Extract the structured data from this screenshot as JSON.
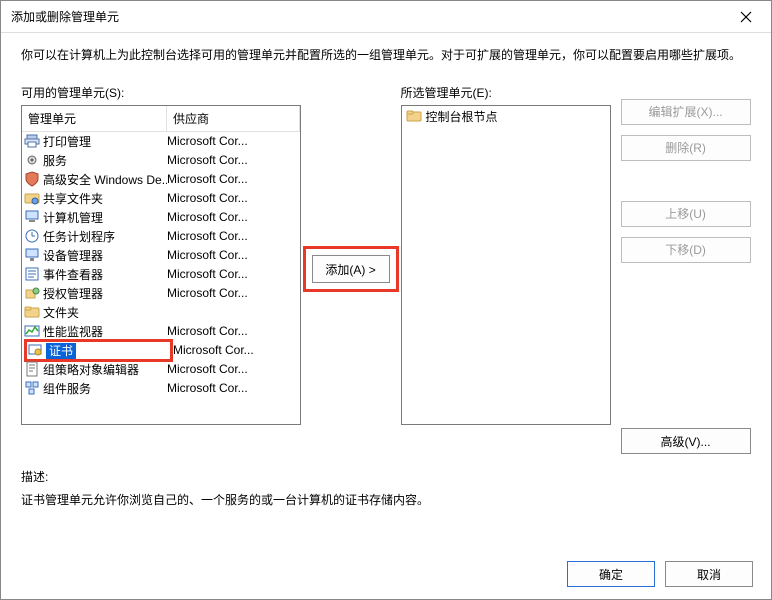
{
  "window": {
    "title": "添加或删除管理单元"
  },
  "intro": "你可以在计算机上为此控制台选择可用的管理单元并配置所选的一组管理单元。对于可扩展的管理单元，你可以配置要启用哪些扩展项。",
  "labels": {
    "available": "可用的管理单元(S):",
    "selected": "所选管理单元(E):",
    "description": "描述:"
  },
  "headers": {
    "name": "管理单元",
    "vendor": "供应商"
  },
  "available_items": [
    {
      "name": "打印管理",
      "vendor": "Microsoft Cor...",
      "icon": "printer"
    },
    {
      "name": "服务",
      "vendor": "Microsoft Cor...",
      "icon": "gear"
    },
    {
      "name": "高级安全 Windows De...",
      "vendor": "Microsoft Cor...",
      "icon": "shield"
    },
    {
      "name": "共享文件夹",
      "vendor": "Microsoft Cor...",
      "icon": "folder-share"
    },
    {
      "name": "计算机管理",
      "vendor": "Microsoft Cor...",
      "icon": "computer"
    },
    {
      "name": "任务计划程序",
      "vendor": "Microsoft Cor...",
      "icon": "clock"
    },
    {
      "name": "设备管理器",
      "vendor": "Microsoft Cor...",
      "icon": "device"
    },
    {
      "name": "事件查看器",
      "vendor": "Microsoft Cor...",
      "icon": "event"
    },
    {
      "name": "授权管理器",
      "vendor": "Microsoft Cor...",
      "icon": "auth"
    },
    {
      "name": "文件夹",
      "vendor": "",
      "icon": "folder"
    },
    {
      "name": "性能监视器",
      "vendor": "Microsoft Cor...",
      "icon": "perf"
    },
    {
      "name": "证书",
      "vendor": "Microsoft Cor...",
      "icon": "cert",
      "selected": true
    },
    {
      "name": "组策略对象编辑器",
      "vendor": "Microsoft Cor...",
      "icon": "policy"
    },
    {
      "name": "组件服务",
      "vendor": "Microsoft Cor...",
      "icon": "component"
    }
  ],
  "selected_root": "控制台根节点",
  "buttons": {
    "add": "添加(A) >",
    "edit_ext": "编辑扩展(X)...",
    "remove": "删除(R)",
    "move_up": "上移(U)",
    "move_down": "下移(D)",
    "advanced": "高级(V)...",
    "ok": "确定",
    "cancel": "取消"
  },
  "description_text": "证书管理单元允许你浏览自己的、一个服务的或一台计算机的证书存储内容。"
}
